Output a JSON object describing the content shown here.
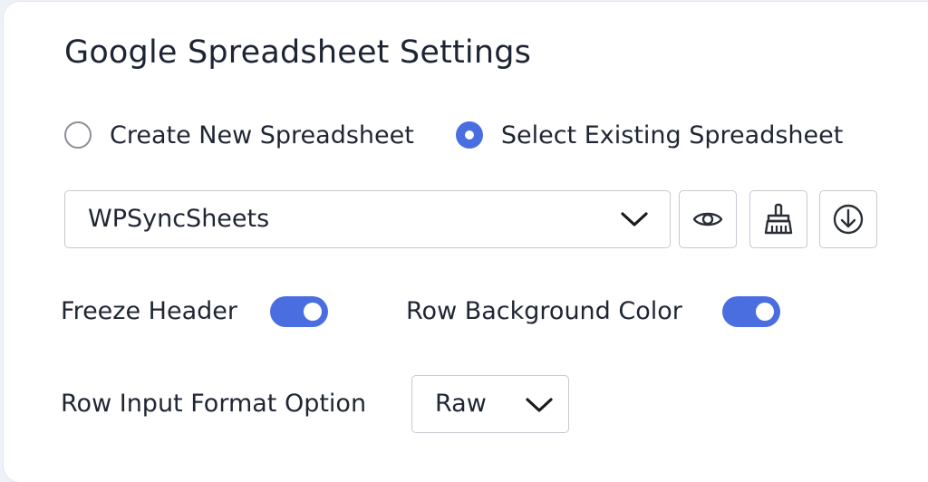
{
  "title": "Google Spreadsheet Settings",
  "spreadsheet_mode": {
    "options": [
      {
        "label": "Create New Spreadsheet",
        "checked": false
      },
      {
        "label": "Select Existing Spreadsheet",
        "checked": true
      }
    ]
  },
  "spreadsheet_select": {
    "value": "WPSyncSheets",
    "icon": "chevron-down-icon"
  },
  "action_buttons": [
    {
      "icon": "eye-icon"
    },
    {
      "icon": "broom-icon"
    },
    {
      "icon": "download-icon"
    }
  ],
  "toggles": {
    "freeze_header": {
      "label": "Freeze Header",
      "on": true
    },
    "row_background_color": {
      "label": "Row Background Color",
      "on": true
    }
  },
  "row_input_format": {
    "label": "Row Input Format Option",
    "value": "Raw"
  },
  "colors": {
    "accent": "#4a6ee0",
    "text": "#1f2533",
    "border": "#c6c9cf"
  }
}
